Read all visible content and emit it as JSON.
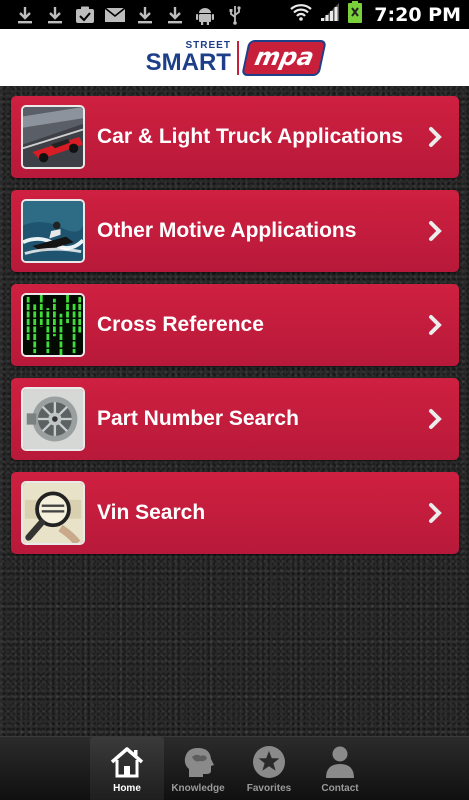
{
  "status_bar": {
    "time": "7:20 PM",
    "left_icons": [
      "download-icon",
      "download-icon",
      "clipboard-check-icon",
      "mail-icon",
      "download-icon",
      "download-icon",
      "android-icon",
      "usb-icon"
    ],
    "right_icons": [
      "wifi-icon",
      "signal-icon",
      "battery-icon"
    ]
  },
  "header": {
    "logo_street": "STREET",
    "logo_smart": "SMART",
    "logo_brand": "mpa"
  },
  "menu": {
    "items": [
      {
        "label": "Car & Light Truck Applications",
        "icon": "race-car-thumbnail"
      },
      {
        "label": "Other Motive Applications",
        "icon": "jet-ski-thumbnail"
      },
      {
        "label": "Cross Reference",
        "icon": "matrix-code-thumbnail"
      },
      {
        "label": "Part Number Search",
        "icon": "alternator-thumbnail"
      },
      {
        "label": "Vin Search",
        "icon": "magnifier-vin-thumbnail"
      }
    ]
  },
  "tabs": {
    "items": [
      {
        "label": "Home",
        "icon": "home-icon",
        "active": true
      },
      {
        "label": "Knowledge",
        "icon": "head-icon",
        "active": false
      },
      {
        "label": "Favorites",
        "icon": "star-icon",
        "active": false
      },
      {
        "label": "Contact",
        "icon": "person-icon",
        "active": false
      }
    ]
  },
  "colors": {
    "accent_red": "#c8203a",
    "brand_blue": "#1d3f8a",
    "background": "#2a2a2a"
  }
}
